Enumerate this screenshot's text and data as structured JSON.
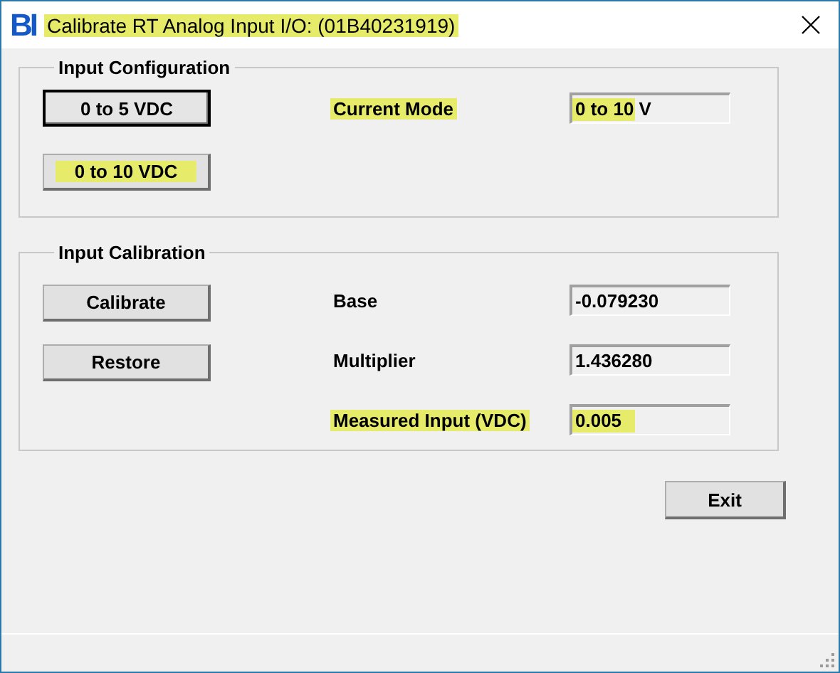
{
  "window": {
    "logo": "BI",
    "title": "Calibrate RT Analog Input I/O: (01B40231919)",
    "title_highlighted": true
  },
  "groups": [
    {
      "title": "Input Configuration",
      "buttons": [
        {
          "label": "0 to 5 VDC",
          "default": true,
          "highlighted": false
        },
        {
          "label": "0 to 10 VDC",
          "default": false,
          "highlighted": true
        }
      ],
      "fields": [
        {
          "label": "Current Mode",
          "value": "0 to 10 V",
          "label_highlighted": true,
          "value_highlighted": true
        }
      ]
    },
    {
      "title": "Input Calibration",
      "buttons": [
        {
          "label": "Calibrate",
          "default": false,
          "highlighted": false
        },
        {
          "label": "Restore",
          "default": false,
          "highlighted": false
        }
      ],
      "fields": [
        {
          "label": "Base",
          "value": "-0.079230",
          "label_highlighted": false,
          "value_highlighted": false
        },
        {
          "label": "Multiplier",
          "value": "1.436280",
          "label_highlighted": false,
          "value_highlighted": false
        },
        {
          "label": "Measured Input (VDC)",
          "value": "0.005",
          "label_highlighted": true,
          "value_highlighted": true
        }
      ]
    }
  ],
  "exit_button": {
    "label": "Exit"
  }
}
